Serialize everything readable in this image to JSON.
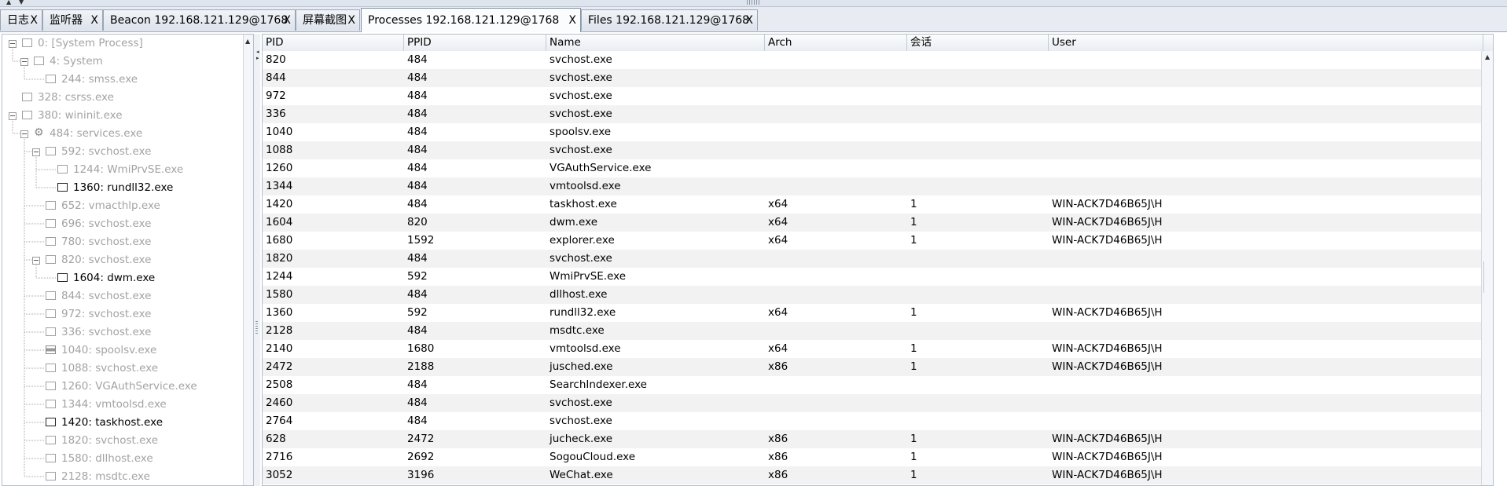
{
  "tabs": [
    {
      "label": "日志",
      "close": "X"
    },
    {
      "label": "监听器",
      "close": "X"
    },
    {
      "label": "Beacon 192.168.121.129@1768",
      "close": "X"
    },
    {
      "label": "屏幕截图",
      "close": "X"
    },
    {
      "label": "Processes 192.168.121.129@1768",
      "close": "X",
      "active": true
    },
    {
      "label": "Files 192.168.121.129@1768",
      "close": "X"
    }
  ],
  "tree": [
    {
      "label": "0: [System Process]",
      "level": 0,
      "toggle": true,
      "icon": "window",
      "dim": true
    },
    {
      "label": "4: System",
      "level": 1,
      "toggle": true,
      "icon": "window",
      "dim": true
    },
    {
      "label": "244: smss.exe",
      "level": 2,
      "toggle": false,
      "icon": "window",
      "dim": true
    },
    {
      "label": "328: csrss.exe",
      "level": 0,
      "toggle": false,
      "icon": "window",
      "dim": true
    },
    {
      "label": "380: wininit.exe",
      "level": 0,
      "toggle": true,
      "icon": "window",
      "dim": true
    },
    {
      "label": "484: services.exe",
      "level": 1,
      "toggle": true,
      "icon": "gear",
      "dim": true
    },
    {
      "label": "592: svchost.exe",
      "level": 2,
      "toggle": true,
      "icon": "window",
      "dim": true
    },
    {
      "label": "1244: WmiPrvSE.exe",
      "level": 3,
      "toggle": false,
      "icon": "window",
      "dim": true
    },
    {
      "label": "1360: rundll32.exe",
      "level": 3,
      "toggle": false,
      "icon": "window",
      "dim": false
    },
    {
      "label": "652: vmacthlp.exe",
      "level": 2,
      "toggle": false,
      "icon": "window",
      "dim": true
    },
    {
      "label": "696: svchost.exe",
      "level": 2,
      "toggle": false,
      "icon": "window",
      "dim": true
    },
    {
      "label": "780: svchost.exe",
      "level": 2,
      "toggle": false,
      "icon": "window",
      "dim": true
    },
    {
      "label": "820: svchost.exe",
      "level": 2,
      "toggle": true,
      "icon": "window",
      "dim": true
    },
    {
      "label": "1604: dwm.exe",
      "level": 3,
      "toggle": false,
      "icon": "window",
      "dim": false
    },
    {
      "label": "844: svchost.exe",
      "level": 2,
      "toggle": false,
      "icon": "window",
      "dim": true
    },
    {
      "label": "972: svchost.exe",
      "level": 2,
      "toggle": false,
      "icon": "window",
      "dim": true
    },
    {
      "label": "336: svchost.exe",
      "level": 2,
      "toggle": false,
      "icon": "window",
      "dim": true
    },
    {
      "label": "1040: spoolsv.exe",
      "level": 2,
      "toggle": false,
      "icon": "printer",
      "dim": true
    },
    {
      "label": "1088: svchost.exe",
      "level": 2,
      "toggle": false,
      "icon": "window",
      "dim": true
    },
    {
      "label": "1260: VGAuthService.exe",
      "level": 2,
      "toggle": false,
      "icon": "window",
      "dim": true
    },
    {
      "label": "1344: vmtoolsd.exe",
      "level": 2,
      "toggle": false,
      "icon": "window",
      "dim": true
    },
    {
      "label": "1420: taskhost.exe",
      "level": 2,
      "toggle": false,
      "icon": "window",
      "dim": false
    },
    {
      "label": "1820: svchost.exe",
      "level": 2,
      "toggle": false,
      "icon": "window",
      "dim": true
    },
    {
      "label": "1580: dllhost.exe",
      "level": 2,
      "toggle": false,
      "icon": "window",
      "dim": true
    },
    {
      "label": "2128: msdtc.exe",
      "level": 2,
      "toggle": false,
      "icon": "window",
      "dim": true
    }
  ],
  "columns": [
    "PID",
    "PPID",
    "Name",
    "Arch",
    "会话",
    "User"
  ],
  "rows": [
    [
      "820",
      "484",
      "svchost.exe",
      "",
      "",
      ""
    ],
    [
      "844",
      "484",
      "svchost.exe",
      "",
      "",
      ""
    ],
    [
      "972",
      "484",
      "svchost.exe",
      "",
      "",
      ""
    ],
    [
      "336",
      "484",
      "svchost.exe",
      "",
      "",
      ""
    ],
    [
      "1040",
      "484",
      "spoolsv.exe",
      "",
      "",
      ""
    ],
    [
      "1088",
      "484",
      "svchost.exe",
      "",
      "",
      ""
    ],
    [
      "1260",
      "484",
      "VGAuthService.exe",
      "",
      "",
      ""
    ],
    [
      "1344",
      "484",
      "vmtoolsd.exe",
      "",
      "",
      ""
    ],
    [
      "1420",
      "484",
      "taskhost.exe",
      "x64",
      "1",
      "WIN-ACK7D46B65J\\H"
    ],
    [
      "1604",
      "820",
      "dwm.exe",
      "x64",
      "1",
      "WIN-ACK7D46B65J\\H"
    ],
    [
      "1680",
      "1592",
      "explorer.exe",
      "x64",
      "1",
      "WIN-ACK7D46B65J\\H"
    ],
    [
      "1820",
      "484",
      "svchost.exe",
      "",
      "",
      ""
    ],
    [
      "1244",
      "592",
      "WmiPrvSE.exe",
      "",
      "",
      ""
    ],
    [
      "1580",
      "484",
      "dllhost.exe",
      "",
      "",
      ""
    ],
    [
      "1360",
      "592",
      "rundll32.exe",
      "x64",
      "1",
      "WIN-ACK7D46B65J\\H"
    ],
    [
      "2128",
      "484",
      "msdtc.exe",
      "",
      "",
      ""
    ],
    [
      "2140",
      "1680",
      "vmtoolsd.exe",
      "x64",
      "1",
      "WIN-ACK7D46B65J\\H"
    ],
    [
      "2472",
      "2188",
      "jusched.exe",
      "x86",
      "1",
      "WIN-ACK7D46B65J\\H"
    ],
    [
      "2508",
      "484",
      "SearchIndexer.exe",
      "",
      "",
      ""
    ],
    [
      "2460",
      "484",
      "svchost.exe",
      "",
      "",
      ""
    ],
    [
      "2764",
      "484",
      "svchost.exe",
      "",
      "",
      ""
    ],
    [
      "628",
      "2472",
      "jucheck.exe",
      "x86",
      "1",
      "WIN-ACK7D46B65J\\H"
    ],
    [
      "2716",
      "2692",
      "SogouCloud.exe",
      "x86",
      "1",
      "WIN-ACK7D46B65J\\H"
    ],
    [
      "3052",
      "3196",
      "WeChat.exe",
      "x86",
      "1",
      "WIN-ACK7D46B65J\\H"
    ]
  ]
}
